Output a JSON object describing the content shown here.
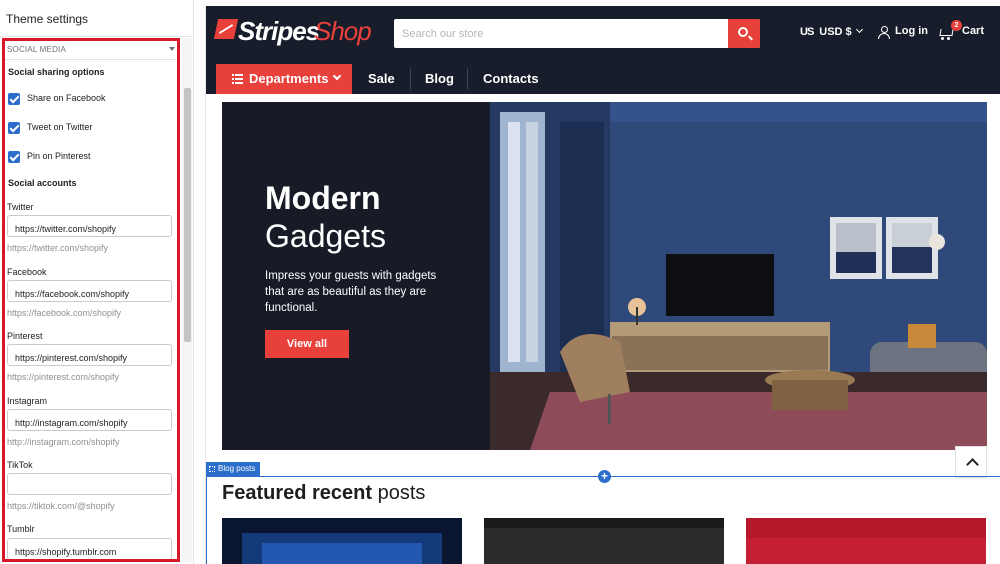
{
  "panel": {
    "title": "Theme settings",
    "section": "SOCIAL MEDIA",
    "sharing_heading": "Social sharing options",
    "checkboxes": [
      {
        "label": "Share on Facebook",
        "checked": true
      },
      {
        "label": "Tweet on Twitter",
        "checked": true
      },
      {
        "label": "Pin on Pinterest",
        "checked": true
      }
    ],
    "accounts_heading": "Social accounts",
    "fields": [
      {
        "label": "Twitter",
        "value": "https://twitter.com/shopify",
        "hint": "https://twitter.com/shopify"
      },
      {
        "label": "Facebook",
        "value": "https://facebook.com/shopify",
        "hint": "https://facebook.com/shopify"
      },
      {
        "label": "Pinterest",
        "value": "https://pinterest.com/shopify",
        "hint": "https://pinterest.com/shopify"
      },
      {
        "label": "Instagram",
        "value": "http://instagram.com/shopify",
        "hint": "http://instagram.com/shopify"
      },
      {
        "label": "TikTok",
        "value": "",
        "hint": "https://tiktok.com/@shopify"
      },
      {
        "label": "Tumblr",
        "value": "https://shopify.tumblr.com",
        "hint": ""
      }
    ]
  },
  "store": {
    "logo_part1": "Stripes",
    "logo_part2": "Shop",
    "search_placeholder": "Search our store",
    "currency": "USD $",
    "flag_text": "US",
    "login": "Log in",
    "cart": "Cart",
    "cart_count": "2",
    "nav": {
      "departments": "Departments",
      "links": [
        "Sale",
        "Blog",
        "Contacts"
      ]
    },
    "hero": {
      "title_line1": "Modern",
      "title_line2": "Gadgets",
      "text": "Impress your guests with gadgets that are as beautiful as they are functional.",
      "cta": "View all"
    },
    "blog": {
      "tag": "Blog posts",
      "heading_bold": "Featured recent",
      "heading_rest": " posts"
    }
  },
  "colors": {
    "accent": "#e8413b",
    "header_bg": "#171d2a",
    "selection": "#d7182a",
    "editor_blue": "#2c6ecb"
  }
}
